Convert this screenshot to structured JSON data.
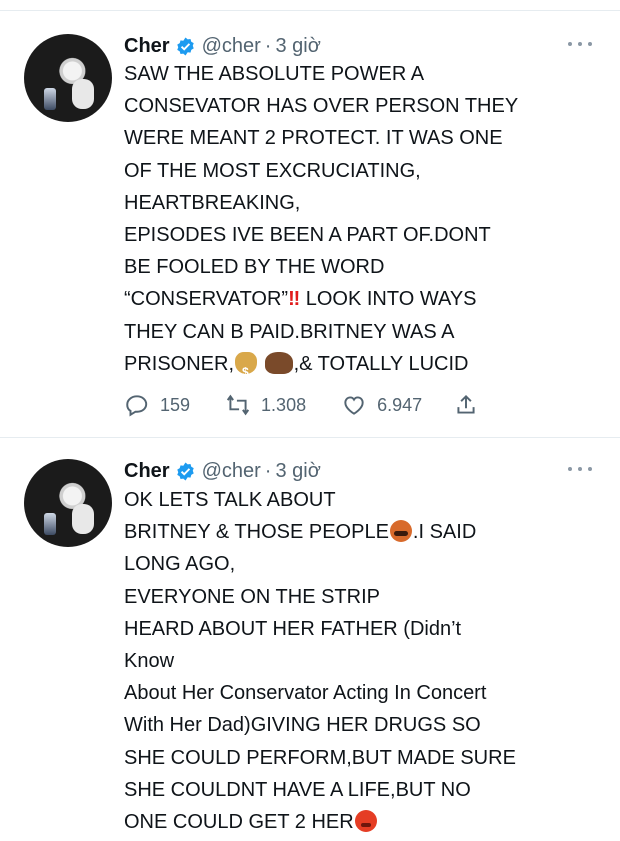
{
  "tweets": [
    {
      "user": {
        "name": "Cher",
        "handle": "@cher",
        "time": "3 giờ"
      },
      "lines": [
        "SAW THE ABSOLUTE POWER A",
        "CONSEVATOR HAS OVER PERSON THEY",
        "WERE MEANT 2 PROTECT. IT WAS ONE",
        "OF THE MOST EXCRUCIATING,",
        "HEARTBREAKING,",
        "EPISODES IVE BEEN A PART OF.DONT",
        "BE FOOLED BY THE WORD",
        "“CONSERVATOR”",
        " LOOK INTO WAYS",
        "THEY CAN B PAID.BRITNEY WAS A",
        "PRISONER,",
        ",& TOTALLY LUCID"
      ],
      "stats": {
        "replies": "159",
        "retweets": "1.308",
        "likes": "6.947"
      },
      "emojis": {
        "double_exclamation": "‼",
        "money_bag": "money-bag-icon",
        "ox": "ox-icon"
      }
    },
    {
      "user": {
        "name": "Cher",
        "handle": "@cher",
        "time": "3 giờ"
      },
      "lines": [
        "OK LETS TALK ABOUT",
        "BRITNEY & THOSE PEOPLE",
        ".I SAID",
        "LONG AGO,",
        "EVERYONE ON THE STRIP",
        "HEARD ABOUT HER FATHER (Didn’t",
        "Know",
        "About Her Conservator Acting In Concert",
        "With Her Dad)GIVING HER DRUGS SO",
        "SHE COULD PERFORM,BUT MADE SURE",
        "SHE COULDNT HAVE A LIFE,BUT NO",
        "ONE COULD GET 2 HER"
      ],
      "emojis": {
        "angry_symbols": "angry-face-icon",
        "mad": "angry-face-icon"
      }
    }
  ],
  "colors": {
    "verified": "#1d9bf0",
    "secondary_text": "#536471"
  }
}
